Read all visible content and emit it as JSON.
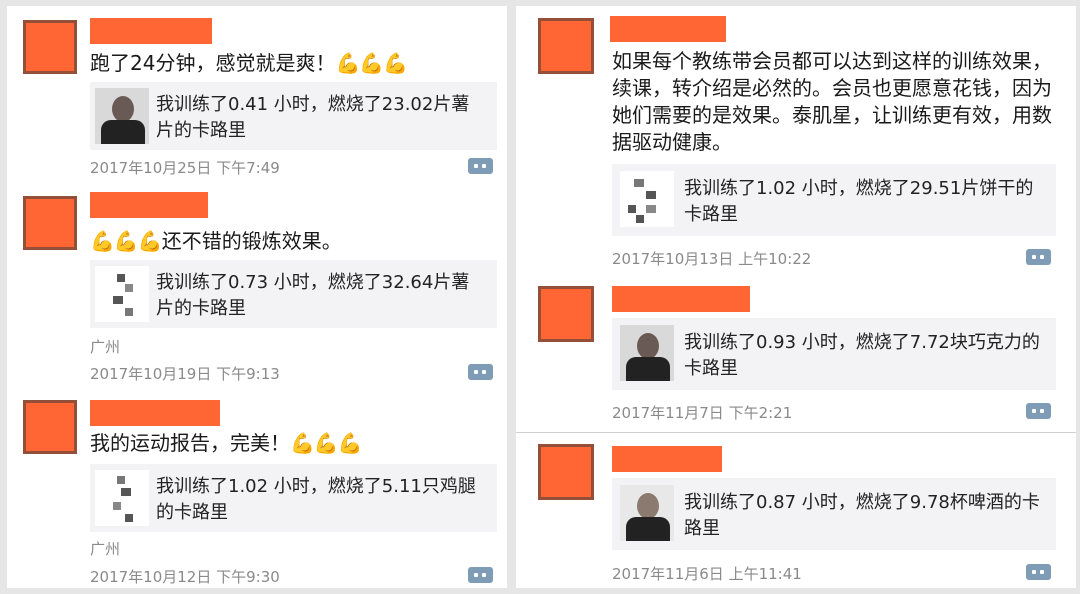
{
  "left_posts": [
    {
      "text": "跑了24分钟，感觉就是爽！",
      "emoji": "💪💪💪",
      "card": "我训练了0.41 小时，燃烧了23.02片薯片的卡路里",
      "location": "",
      "time": "2017年10月25日 下午7:49"
    },
    {
      "text": "还不错的锻炼效果。",
      "emoji": "💪💪💪",
      "card": "我训练了0.73 小时，燃烧了32.64片薯片的卡路里",
      "location": "广州",
      "time": "2017年10月19日 下午9:13"
    },
    {
      "text": "我的运动报告，完美！",
      "emoji": "💪💪💪",
      "card": "我训练了1.02 小时，燃烧了5.11只鸡腿的卡路里",
      "location": "广州",
      "time": "2017年10月12日 下午9:30"
    }
  ],
  "right_posts": [
    {
      "text": "如果每个教练带会员都可以达到这样的训练效果，续课，转介绍是必然的。会员也更愿意花钱，因为她们需要的是效果。泰肌星，让训练更有效，用数据驱动健康。",
      "card": "我训练了1.02 小时，燃烧了29.51片饼干的卡路里",
      "time": "2017年10月13日 上午10:22"
    },
    {
      "text": "",
      "card": "我训练了0.93 小时，燃烧了7.72块巧克力的卡路里",
      "time": "2017年11月7日 下午2:21"
    },
    {
      "text": "",
      "card": "我训练了0.87 小时，燃烧了9.78杯啤酒的卡路里",
      "time": "2017年11月6日 上午11:41"
    }
  ],
  "colors": {
    "avatar": "#ff6633",
    "comment_icon": "#7f9cb7",
    "meta": "#8a8a8a"
  },
  "icons": {
    "comment": "comment-icon",
    "flexed_bicep": "flexed-bicep-emoji"
  }
}
